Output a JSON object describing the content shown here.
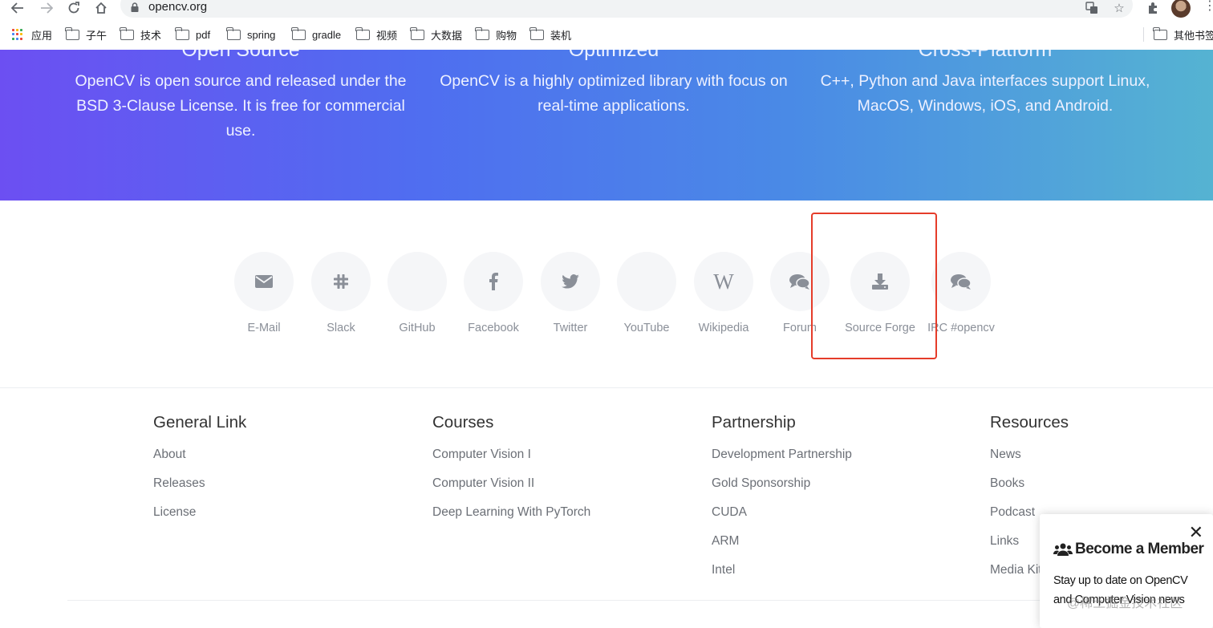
{
  "browser": {
    "url": "opencv.org",
    "bookmarks": [
      "应用",
      "子午",
      "技术",
      "pdf",
      "spring",
      "gradle",
      "视频",
      "大数据",
      "购物",
      "装机"
    ],
    "other_bookmarks": "其他书签"
  },
  "hero": {
    "features": [
      {
        "title": "Open Source",
        "text": "OpenCV is open source and released under the BSD 3-Clause License. It is free for commercial use."
      },
      {
        "title": "Optimized",
        "text": "OpenCV is a highly optimized library with focus on real-time applications."
      },
      {
        "title": "Cross-Platform",
        "text": "C++, Python and Java interfaces support Linux, MacOS, Windows, iOS, and Android."
      }
    ]
  },
  "social": [
    {
      "label": "E-Mail",
      "icon": "envelope-icon"
    },
    {
      "label": "Slack",
      "icon": "slack-icon"
    },
    {
      "label": "GitHub",
      "icon": "github-icon"
    },
    {
      "label": "Facebook",
      "icon": "facebook-icon"
    },
    {
      "label": "Twitter",
      "icon": "twitter-icon"
    },
    {
      "label": "YouTube",
      "icon": "youtube-icon"
    },
    {
      "label": "Wikipedia",
      "icon": "wikipedia-icon"
    },
    {
      "label": "Forum",
      "icon": "comments-icon"
    },
    {
      "label": "Source Forge",
      "icon": "download-icon"
    },
    {
      "label": "IRC #opencv",
      "icon": "comments-icon"
    }
  ],
  "footer": {
    "columns": [
      {
        "heading": "General Link",
        "links": [
          "About",
          "Releases",
          "License"
        ]
      },
      {
        "heading": "Courses",
        "links": [
          "Computer Vision I",
          "Computer Vision II",
          "Deep Learning With PyTorch"
        ]
      },
      {
        "heading": "Partnership",
        "links": [
          "Development Partnership",
          "Gold Sponsorship",
          "CUDA",
          "ARM",
          "Intel"
        ]
      },
      {
        "heading": "Resources",
        "links": [
          "News",
          "Books",
          "Podcast",
          "Links",
          "Media Kit"
        ]
      }
    ]
  },
  "popup": {
    "title": "Become a Member",
    "text": "Stay up to date on OpenCV and Computer Vision news",
    "close": "✕"
  },
  "watermark": "@稀土掘金技术社区",
  "colors": {
    "hero_start": "#6c4ff2",
    "hero_end": "#55b3d2",
    "highlight": "#e53c2a"
  }
}
